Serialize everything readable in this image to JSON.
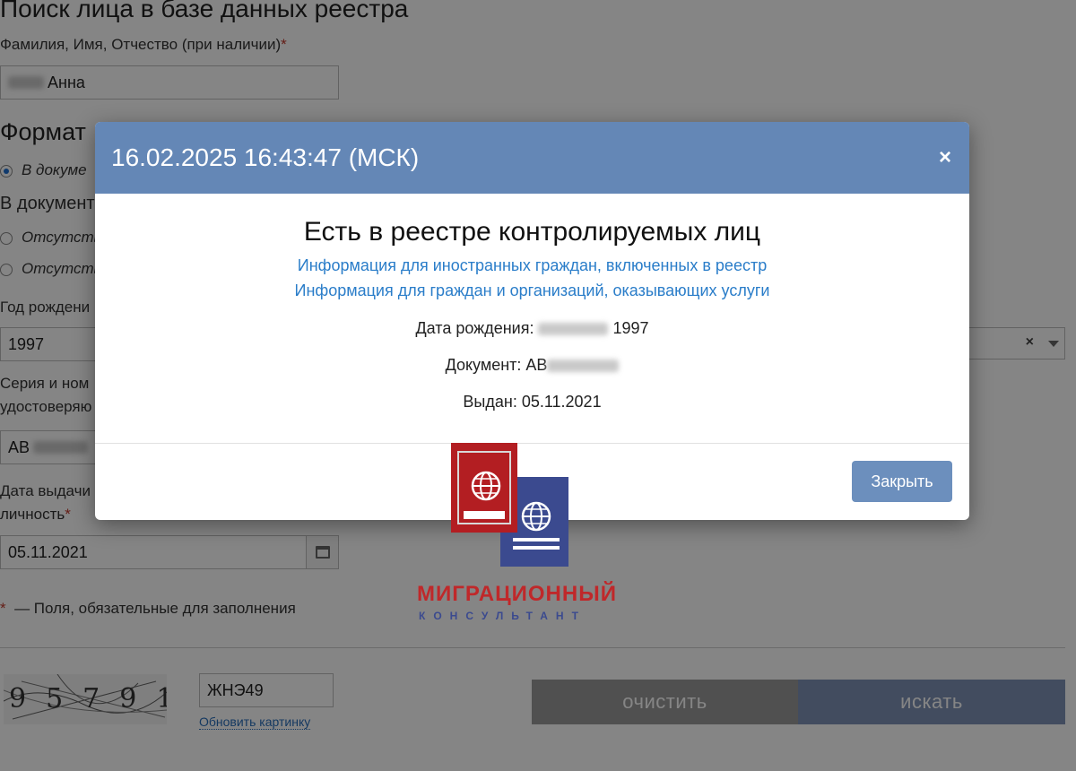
{
  "form": {
    "page_title": "Поиск лица в базе данных реестра",
    "fio_label": "Фамилия, Имя, Отчество (при наличии)",
    "required_mark": "*",
    "fio_value_visible": "Анна",
    "format_title": "Формат",
    "radio_in_doc": "В докуме",
    "in_doc_label": "В документ",
    "radio_absent_1": "Отсутству",
    "radio_absent_2": "Отсутству",
    "birth_year_label": "Год рождени",
    "birth_year_value": "1997",
    "series_label_1": "Серия и ном",
    "series_label_2": "удостоверяю",
    "series_value_prefix": "АВ",
    "issue_label_1": "Дата выдачи",
    "issue_label_2": "личность",
    "issue_value": "05.11.2021",
    "required_note": "— Поля, обязательные для заполнения",
    "captcha_text": "95791",
    "captcha_input_value": "ЖНЭ49",
    "refresh_link": "Обновить картинку",
    "clear_button": "очистить",
    "search_button": "искать"
  },
  "modal": {
    "title": "16.02.2025 16:43:47 (МСК)",
    "close_x": "×",
    "result_title": "Есть в реестре контролируемых лиц",
    "link_1": "Информация для иностранных граждан, включенных в реестр",
    "link_2": "Информация для граждан и организаций, оказывающих услуги",
    "dob_label": "Дата рождения:",
    "dob_year": "1997",
    "doc_label": "Документ: АВ",
    "issued_label": "Выдан: 05.11.2021",
    "close_button": "Закрыть"
  },
  "logo": {
    "line1": "МИГРАЦИОННЫЙ",
    "line2": "КОНСУЛЬТАНТ"
  },
  "colors": {
    "modal_header": "#6487b6",
    "close_button": "#6c8fbd",
    "link": "#2a7dc9",
    "logo_red": "#c0282a",
    "logo_blue": "#3b4a8f"
  }
}
